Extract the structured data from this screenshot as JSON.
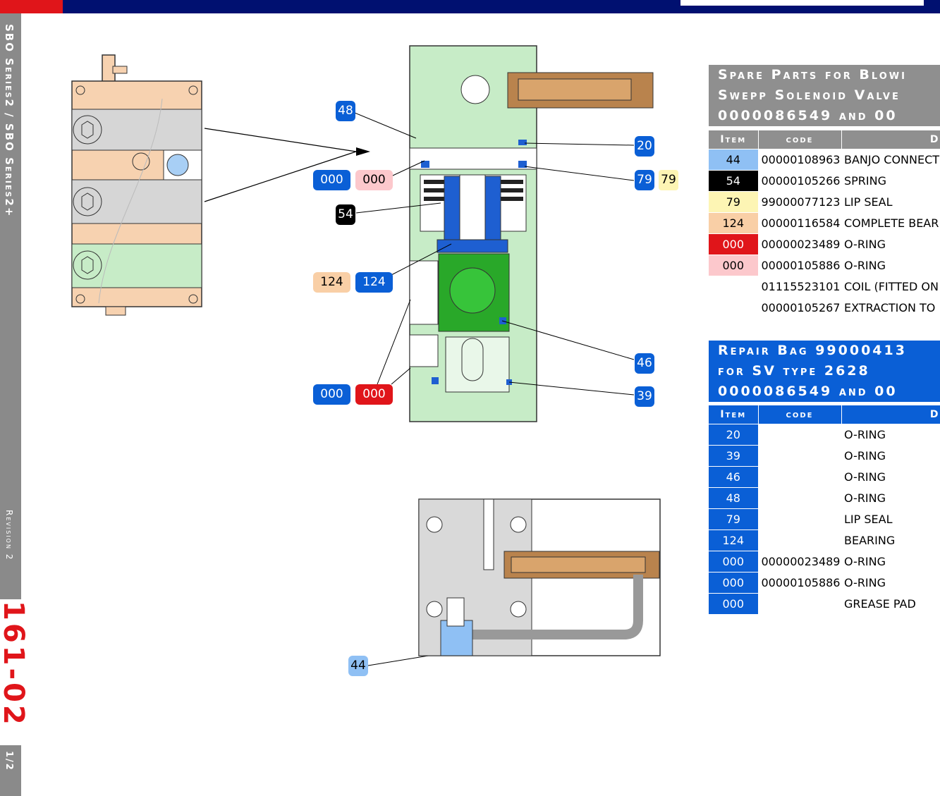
{
  "header": {
    "accent_color": "#e0151a",
    "bar_color": "#001070"
  },
  "sidebar": {
    "series": "SBO Series2 / SBO Series2+",
    "revision": "Revision 2",
    "page_code": "161-02",
    "page_fraction": "1/2"
  },
  "callouts": {
    "c48": "48",
    "c20": "20",
    "c79": "79",
    "c79b": "79",
    "c000_pink_blue": "000",
    "c000_pink": "000",
    "c54": "54",
    "c124_peach": "124",
    "c124_blue": "124",
    "c46": "46",
    "c39": "39",
    "c000_red_blue": "000",
    "c000_red": "000",
    "c44": "44"
  },
  "spare_parts": {
    "title_lines": [
      "Spare Parts for Blowi",
      "Swepp Solenoid Valve",
      "0000086549 and 00"
    ],
    "headers": {
      "item": "Item",
      "code": "code",
      "desc": "D"
    },
    "rows": [
      {
        "item": "44",
        "code": "00000108963",
        "desc": "BANJO CONNECT",
        "color": "#8fc0f4",
        "text_color": "#000"
      },
      {
        "item": "54",
        "code": "00000105266",
        "desc": "SPRING",
        "color": "#000000",
        "text_color": "#fff"
      },
      {
        "item": "79",
        "code": "99000077123",
        "desc": "LIP SEAL",
        "color": "#fdf5b4",
        "text_color": "#000"
      },
      {
        "item": "124",
        "code": "00000116584",
        "desc": "COMPLETE BEAR",
        "color": "#f9cfa6",
        "text_color": "#000"
      },
      {
        "item": "000",
        "code": "00000023489",
        "desc": "O-RING",
        "color": "#e0151a",
        "text_color": "#fff"
      },
      {
        "item": "000",
        "code": "00000105886",
        "desc": "O-RING",
        "color": "#fcc8cc",
        "text_color": "#000"
      },
      {
        "item": "",
        "code": "01115523101",
        "desc": "COIL (FITTED ON",
        "color": "#ffffff",
        "text_color": "#000"
      },
      {
        "item": "",
        "code": "00000105267",
        "desc": "EXTRACTION TO",
        "color": "#ffffff",
        "text_color": "#000"
      }
    ]
  },
  "repair_bag": {
    "title_lines": [
      "Repair Bag 99000413",
      "for SV type 2628",
      "0000086549 and 00"
    ],
    "headers": {
      "item": "Item",
      "code": "code",
      "desc": "D"
    },
    "rows": [
      {
        "item": "20",
        "code": "",
        "desc": "O-RING"
      },
      {
        "item": "39",
        "code": "",
        "desc": "O-RING"
      },
      {
        "item": "46",
        "code": "",
        "desc": "O-RING"
      },
      {
        "item": "48",
        "code": "",
        "desc": "O-RING"
      },
      {
        "item": "79",
        "code": "",
        "desc": "LIP SEAL"
      },
      {
        "item": "124",
        "code": "",
        "desc": "BEARING"
      },
      {
        "item": "000",
        "code": "00000023489",
        "desc": "O-RING"
      },
      {
        "item": "000",
        "code": "00000105886",
        "desc": "O-RING"
      },
      {
        "item": "000",
        "code": "",
        "desc": "GREASE PAD"
      }
    ]
  }
}
